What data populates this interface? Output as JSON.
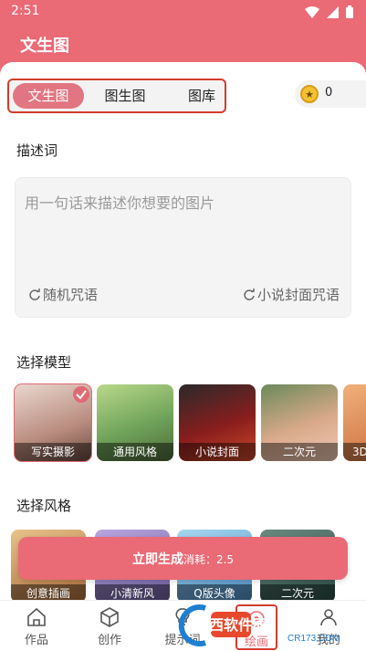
{
  "status_bar": {
    "time": "2:51"
  },
  "header": {
    "title": "文生图"
  },
  "tabs": [
    {
      "label": "文生图",
      "active": true
    },
    {
      "label": "图生图",
      "active": false
    },
    {
      "label": "图库",
      "active": false
    }
  ],
  "coins": {
    "count": "0"
  },
  "prompt_section": {
    "title": "描述词",
    "placeholder": "用一句话来描述你想要的图片",
    "random_label": "随机咒语",
    "novel_cover_label": "小说封面咒语"
  },
  "model_section": {
    "title": "选择模型",
    "models": [
      {
        "label": "写实摄影",
        "selected": true,
        "color": "#c9a89a"
      },
      {
        "label": "通用风格",
        "selected": false,
        "color": "#8fb36b"
      },
      {
        "label": "小说封面",
        "selected": false,
        "color": "#5a1d1d"
      },
      {
        "label": "二次元",
        "selected": false,
        "color": "#c9a47a"
      },
      {
        "label": "3D",
        "selected": false,
        "color": "#d9935a"
      }
    ]
  },
  "style_section": {
    "title": "选择风格",
    "styles": [
      {
        "label": "创意插画",
        "color": "#b3865b"
      },
      {
        "label": "小清新风",
        "color": "#7b6fa3"
      },
      {
        "label": "Q版头像",
        "color": "#6aa3c9"
      },
      {
        "label": "二次元",
        "color": "#3e5f5a"
      }
    ]
  },
  "generate": {
    "label": "立即生成",
    "cost": "消耗：2.5"
  },
  "nav": [
    {
      "label": "作品",
      "icon": "home-icon",
      "active": false
    },
    {
      "label": "创作",
      "icon": "cube-icon",
      "active": false
    },
    {
      "label": "提示词",
      "icon": "bulb-icon",
      "active": false
    },
    {
      "label": "绘画",
      "icon": "brush-icon",
      "active": true
    },
    {
      "label": "我的",
      "icon": "user-icon",
      "active": false
    }
  ],
  "watermark": {
    "text": "西西软件园",
    "sub": "CR173.COM"
  },
  "colors": {
    "accent": "#ea6a76",
    "highlight_border": "#d43c2c"
  }
}
